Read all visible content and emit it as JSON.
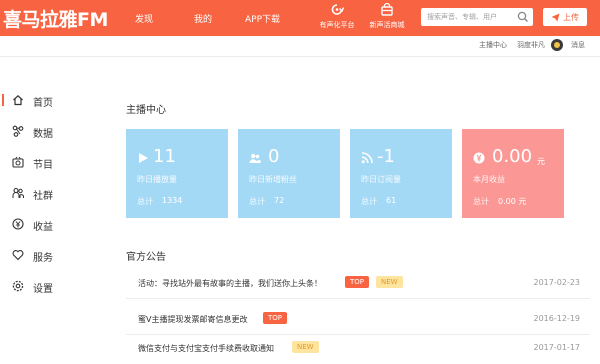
{
  "header": {
    "logo": "喜马拉雅FM",
    "nav": [
      "发现",
      "我的",
      "APP下载"
    ],
    "tools": [
      "有声化平台",
      "新声活商城"
    ],
    "search_placeholder": "搜索声音、专辑、用户",
    "upload_label": "上传"
  },
  "subbar": {
    "links": [
      "主播中心",
      "羽度非凡",
      "消息"
    ]
  },
  "sidebar": {
    "items": [
      {
        "label": "首页",
        "icon": "home-icon",
        "active": true
      },
      {
        "label": "数据",
        "icon": "data-icon"
      },
      {
        "label": "节目",
        "icon": "program-icon"
      },
      {
        "label": "社群",
        "icon": "community-icon"
      },
      {
        "label": "收益",
        "icon": "income-icon"
      },
      {
        "label": "服务",
        "icon": "service-icon"
      },
      {
        "label": "设置",
        "icon": "settings-icon"
      }
    ]
  },
  "main": {
    "section_title": "主播中心",
    "cards": [
      {
        "value": "11",
        "caption": "昨日播放量",
        "total_label": "总计",
        "total": "1334",
        "color": "#a4d9f6",
        "icon": "play-icon"
      },
      {
        "value": "0",
        "caption": "昨日新增粉丝",
        "total_label": "总计",
        "total": "72",
        "color": "#a4d9f6",
        "icon": "fans-icon"
      },
      {
        "value": "-1",
        "caption": "昨日订阅量",
        "total_label": "总计",
        "total": "61",
        "color": "#a4d9f6",
        "icon": "rss-icon"
      },
      {
        "value": "0.00",
        "unit": "元",
        "caption": "本月收益",
        "total_label": "总计",
        "total": "0.00 元",
        "color": "#fb9795",
        "icon": "yen-icon"
      }
    ],
    "notice_title": "官方公告",
    "notices": [
      {
        "text": "活动：寻找站外最有故事的主播，我们送你上头条！",
        "tags": [
          "TOP",
          "NEW"
        ],
        "date": "2017-02-23"
      },
      {
        "text": "蜜V主播提现发票邮寄信息更改",
        "tags": [
          "TOP"
        ],
        "date": "2016-12-19"
      },
      {
        "text": "微信支付与支付宝支付手续费收取通知",
        "tags": [
          "NEW"
        ],
        "date": "2017-01-17"
      }
    ]
  },
  "colors": {
    "brand": "#f86442",
    "card_blue": "#a4d9f6",
    "card_red": "#fb9795"
  }
}
